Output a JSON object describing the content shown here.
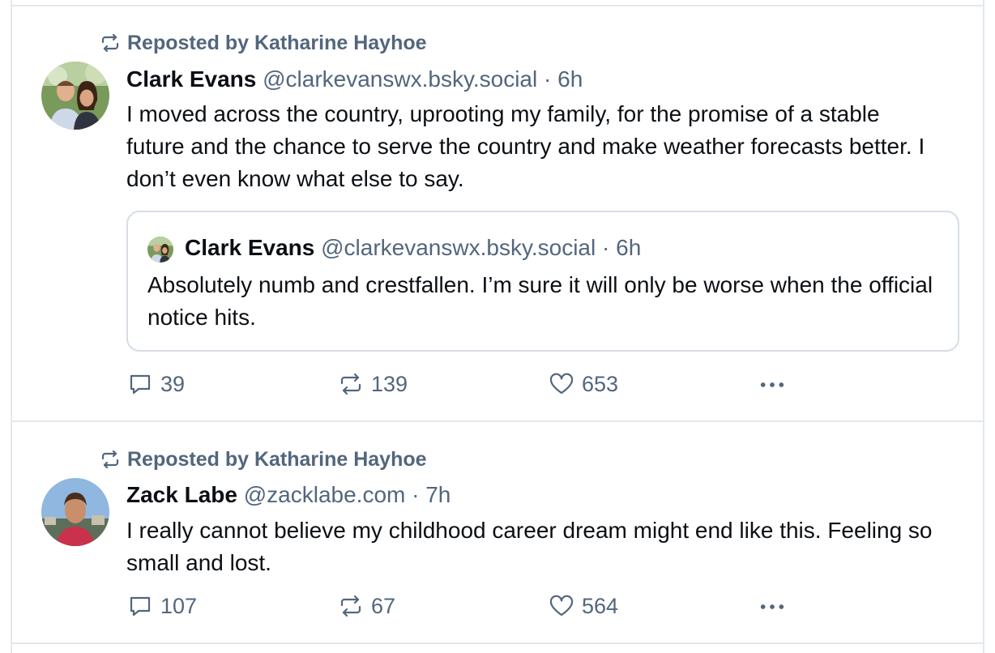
{
  "feed": {
    "posts": [
      {
        "repost_label": "Reposted by Katharine Hayhoe",
        "author": {
          "name": "Clark Evans",
          "handle": "@clarkevanswx.bsky.social",
          "time": "6h",
          "avatar_icon": "avatar-couple"
        },
        "text": "I moved across the country, uprooting my family, for the promise of a stable future and the chance to serve the country and make weather forecasts better. I don’t even know what else to say.",
        "quote": {
          "author": {
            "name": "Clark Evans",
            "handle": "@clarkevanswx.bsky.social",
            "time": "6h"
          },
          "text": "Absolutely numb and crestfallen. I’m sure it will only be worse when the official notice hits."
        },
        "counts": {
          "replies": "39",
          "reposts": "139",
          "likes": "653"
        }
      },
      {
        "repost_label": "Reposted by Katharine Hayhoe",
        "author": {
          "name": "Zack Labe",
          "handle": "@zacklabe.com",
          "time": "7h",
          "avatar_icon": "avatar-man"
        },
        "text": "I really cannot believe my childhood career dream might end like this. Feeling so small and lost.",
        "counts": {
          "replies": "107",
          "reposts": "67",
          "likes": "564"
        }
      }
    ],
    "separator": "·"
  },
  "colors": {
    "muted": "#52667d",
    "border": "#e3e8ee",
    "text": "#0b0f14"
  }
}
